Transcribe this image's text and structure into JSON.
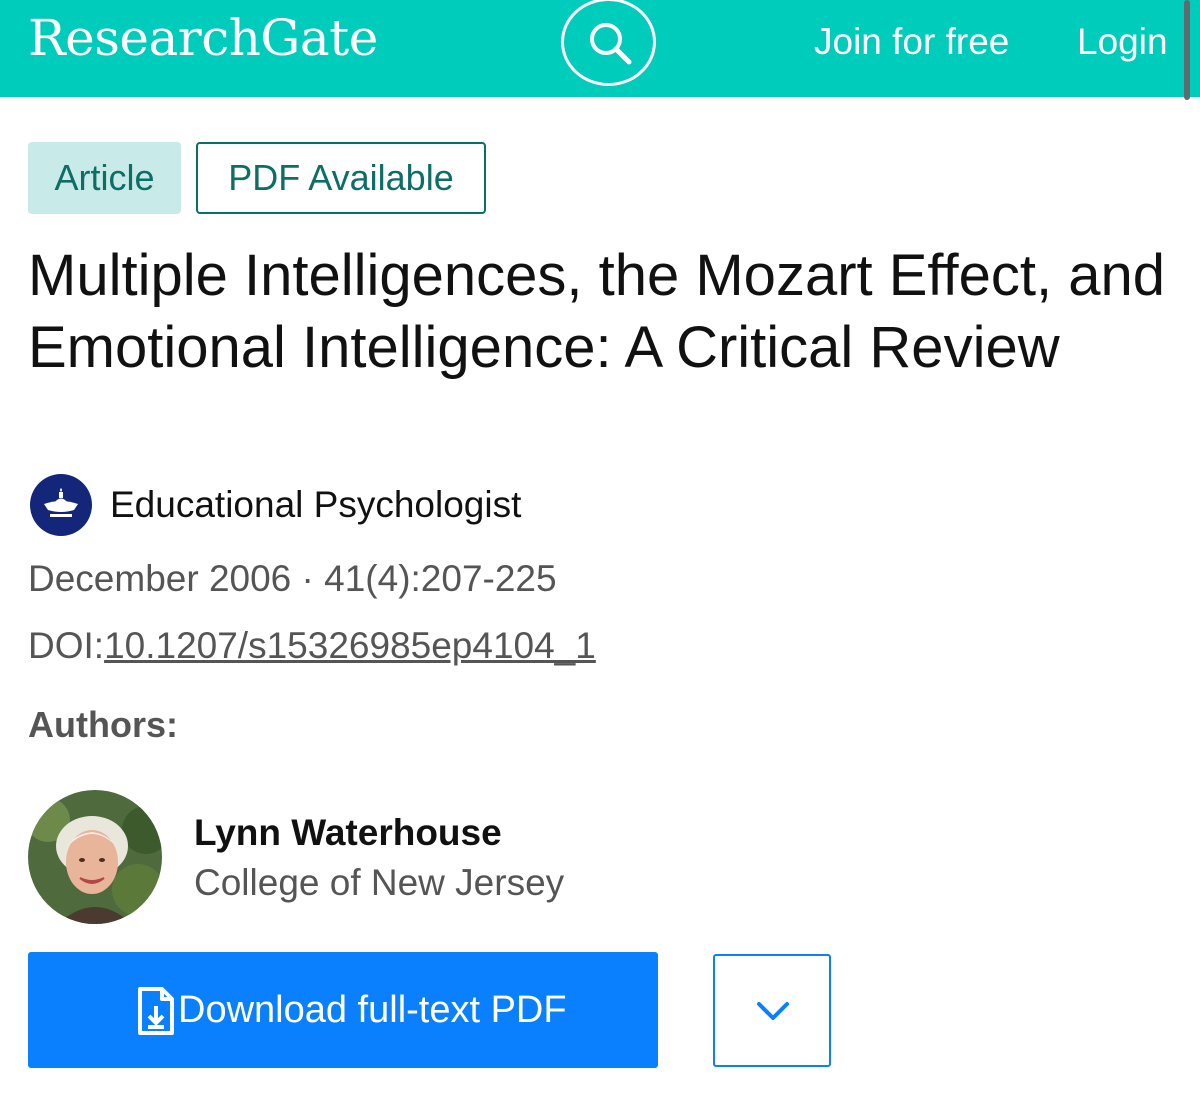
{
  "header": {
    "logo": "ResearchGate",
    "search_icon": "search-icon",
    "join_label": "Join for free",
    "login_label": "Login",
    "brand_color": "#00ccbb"
  },
  "badges": {
    "article": "Article",
    "pdf": "PDF Available"
  },
  "article": {
    "title": "Multiple Intelligences, the Mozart Effect, and Emotional Intelligence: A Critical Review",
    "journal": "Educational Psychologist",
    "journal_icon": "lamp-icon",
    "date_volume": "December 2006 · 41(4):207-225",
    "doi_prefix": "DOI:",
    "doi": "10.1207/s15326985ep4104_1"
  },
  "authors": {
    "heading": "Authors:",
    "list": [
      {
        "name": "Lynn Waterhouse",
        "affiliation": "College of New Jersey"
      }
    ]
  },
  "actions": {
    "download_label": "Download full-text PDF",
    "download_icon": "file-download-icon",
    "more_icon": "chevron-down-icon",
    "accent_color": "#0a80ff"
  }
}
